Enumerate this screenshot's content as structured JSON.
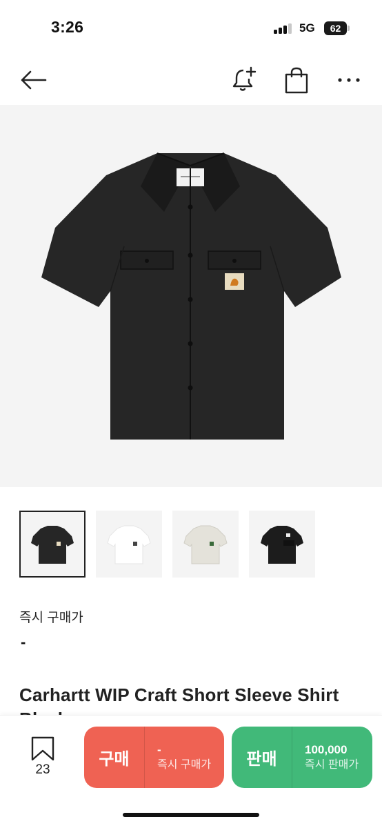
{
  "status": {
    "time": "3:26",
    "network": "5G",
    "battery": "62",
    "signal_bars": 3
  },
  "nav": {
    "back_icon": "arrow-left-icon",
    "alert_icon": "bell-plus-icon",
    "bag_icon": "shopping-bag-icon",
    "more_icon": "more-horizontal-icon"
  },
  "product": {
    "title": "Carhartt WIP Craft Short Sleeve Shirt Black",
    "instant_price_label": "즉시 구매가",
    "instant_price_value": "-",
    "colors": {
      "main_shirt": "#262626",
      "hero_bg": "#f4f4f4"
    },
    "thumbnails": [
      {
        "color": "#262626",
        "selected": true
      },
      {
        "color": "#ffffff",
        "selected": false
      },
      {
        "color": "#e4e2da",
        "selected": false
      },
      {
        "color": "#1c1c1c",
        "selected": false
      }
    ]
  },
  "bottom_bar": {
    "wishlist_count": "23",
    "buy": {
      "label": "구매",
      "price": "-",
      "sub": "즉시 구매가",
      "color": "#ef6253"
    },
    "sell": {
      "label": "판매",
      "price": "100,000",
      "sub": "즉시 판매가",
      "color": "#41b979"
    }
  }
}
